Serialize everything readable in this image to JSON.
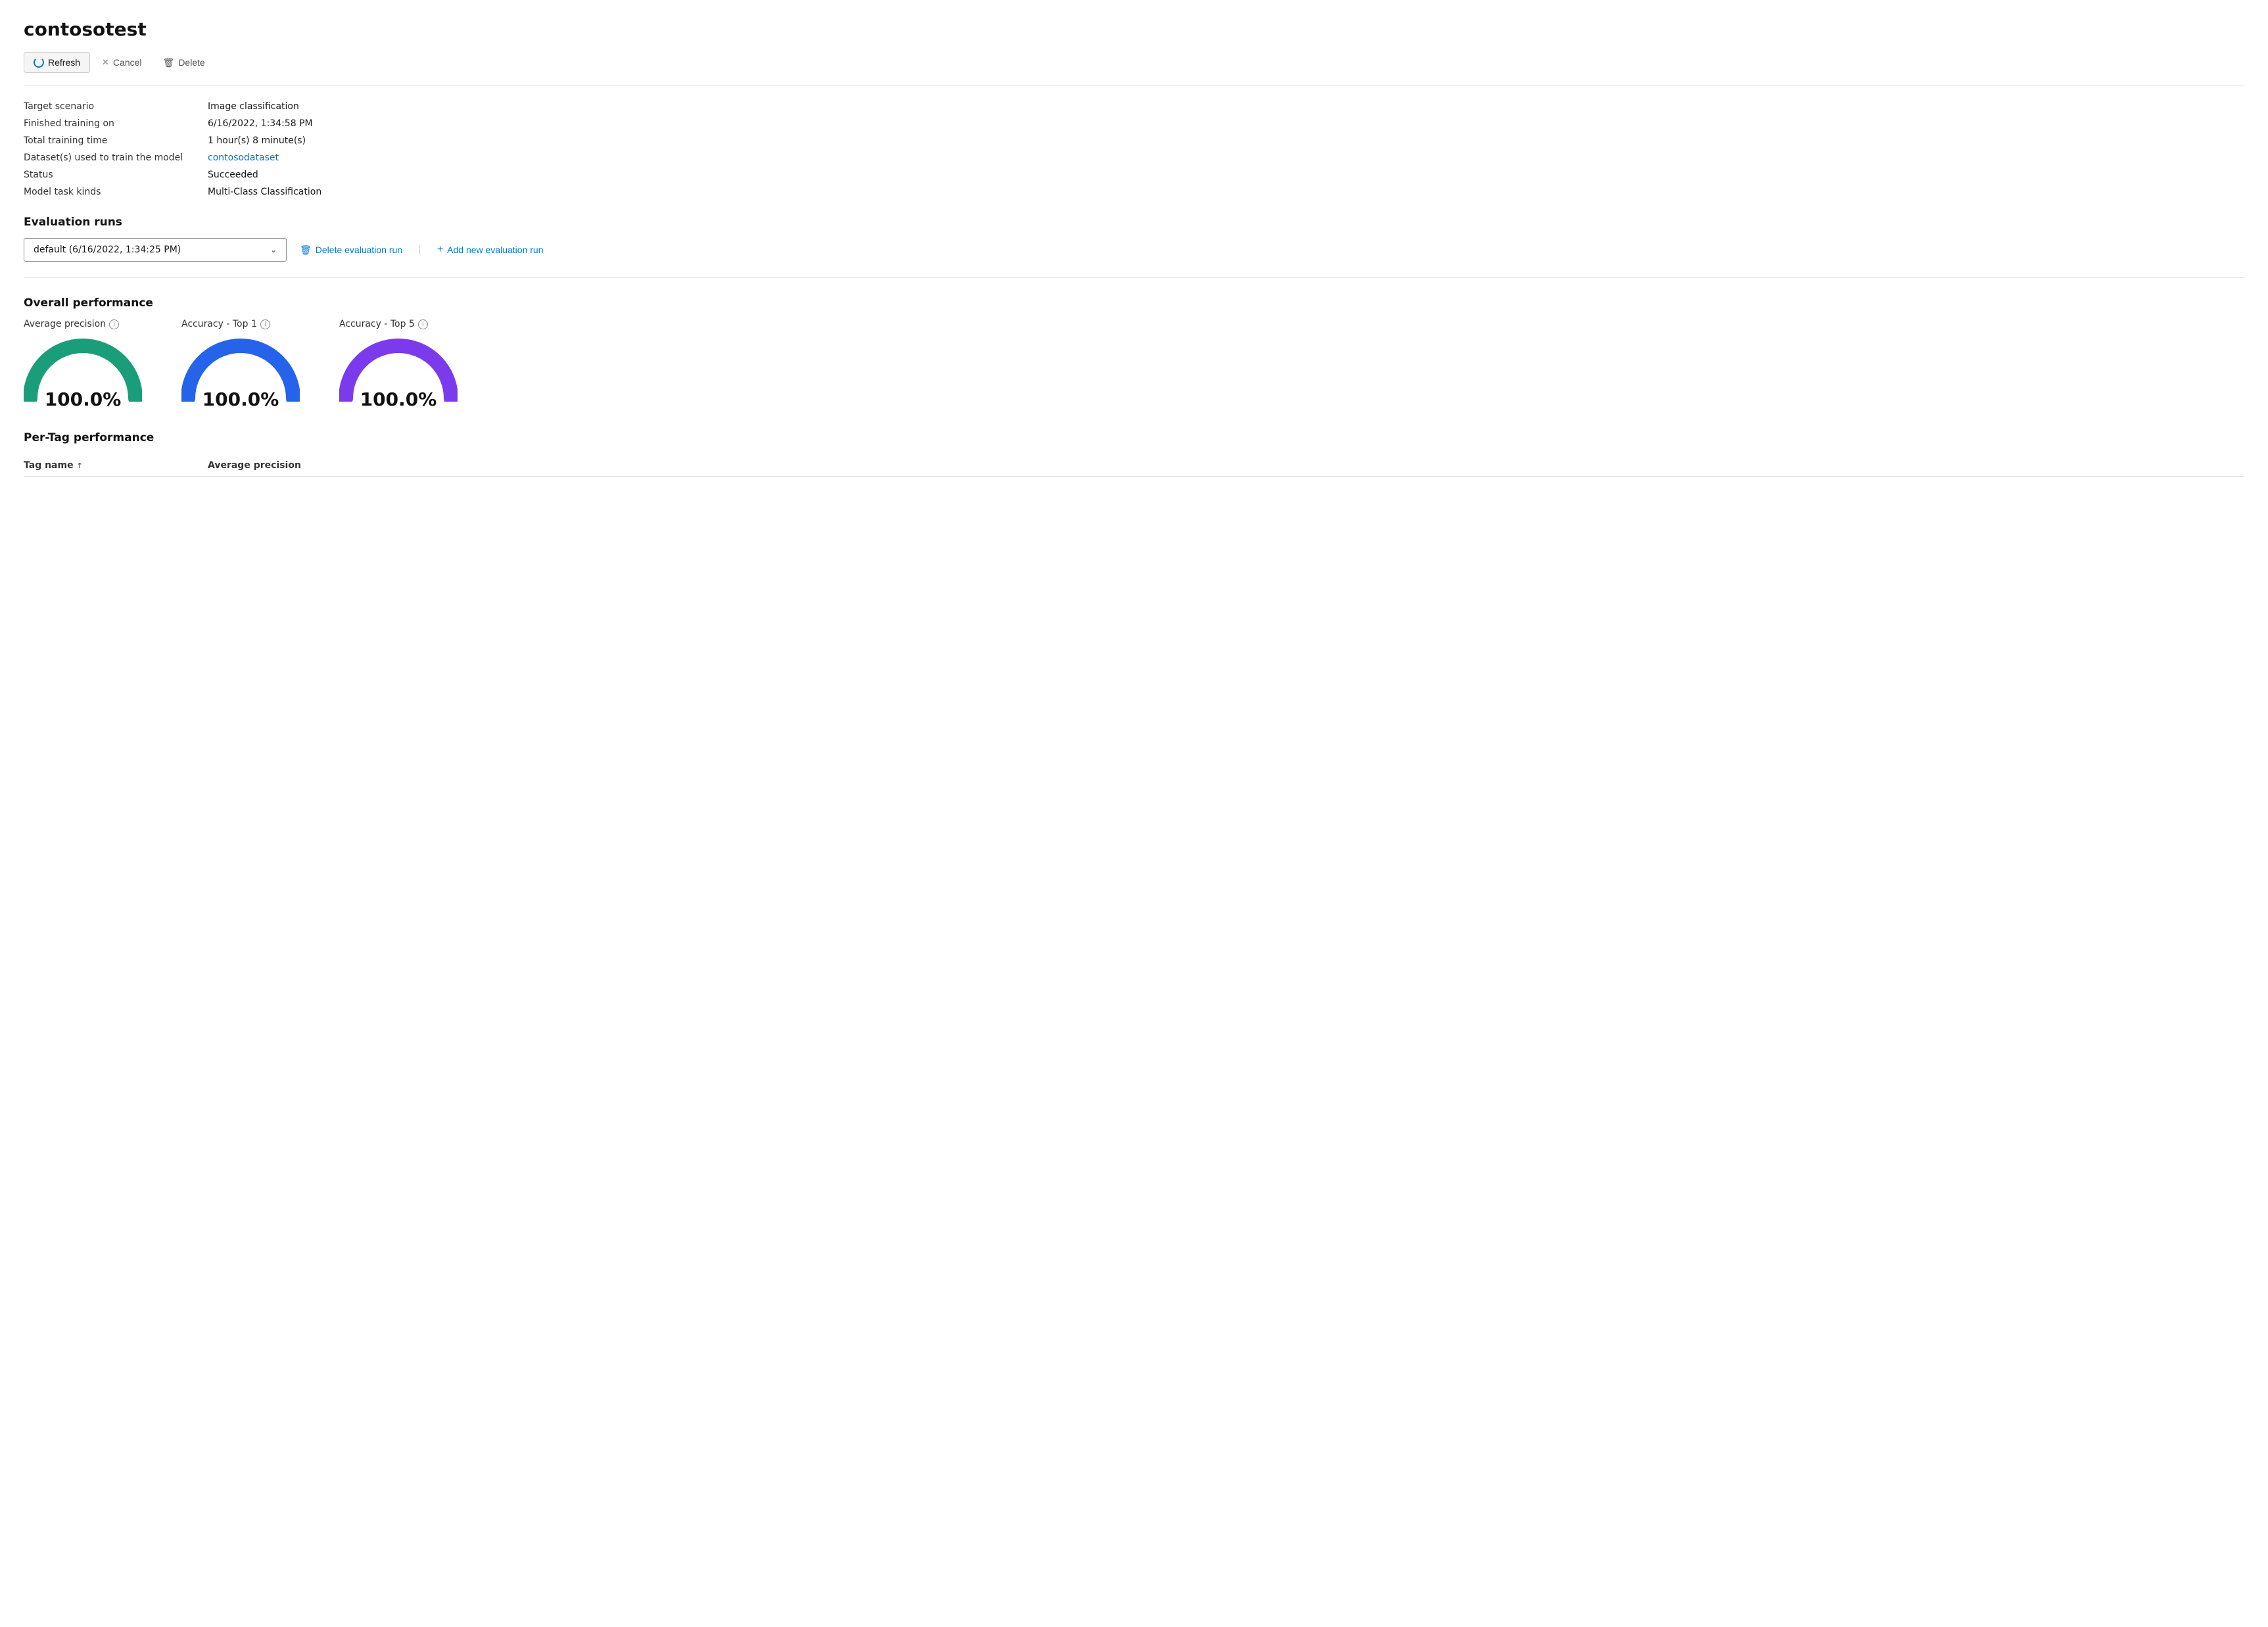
{
  "page": {
    "title": "contosotest"
  },
  "toolbar": {
    "refresh_label": "Refresh",
    "cancel_label": "Cancel",
    "delete_label": "Delete"
  },
  "info": {
    "rows": [
      {
        "label": "Target scenario",
        "value": "Image classification",
        "type": "text"
      },
      {
        "label": "Finished training on",
        "value": "6/16/2022, 1:34:58 PM",
        "type": "text"
      },
      {
        "label": "Total training time",
        "value": "1 hour(s) 8 minute(s)",
        "type": "text"
      },
      {
        "label": "Dataset(s) used to train the model",
        "value": "contosodataset",
        "type": "link"
      },
      {
        "label": "Status",
        "value": "Succeeded",
        "type": "text"
      },
      {
        "label": "Model task kinds",
        "value": "Multi-Class Classification",
        "type": "text"
      }
    ]
  },
  "evaluation_runs": {
    "section_title": "Evaluation runs",
    "dropdown_value": "default (6/16/2022, 1:34:25 PM)",
    "delete_label": "Delete evaluation run",
    "add_label": "Add new evaluation run"
  },
  "overall_performance": {
    "section_title": "Overall performance",
    "gauges": [
      {
        "label": "Average precision",
        "value": "100.0%",
        "color": "#1a9e7a"
      },
      {
        "label": "Accuracy - Top 1",
        "value": "100.0%",
        "color": "#2563eb"
      },
      {
        "label": "Accuracy - Top 5",
        "value": "100.0%",
        "color": "#7c3aed"
      }
    ]
  },
  "per_tag": {
    "section_title": "Per-Tag performance",
    "columns": [
      {
        "label": "Tag name",
        "sort": "↑"
      },
      {
        "label": "Average precision"
      }
    ]
  },
  "icons": {
    "refresh": "↻",
    "cancel": "✕",
    "delete": "🗑",
    "chevron_down": "⌄",
    "plus": "+",
    "info": "i"
  }
}
